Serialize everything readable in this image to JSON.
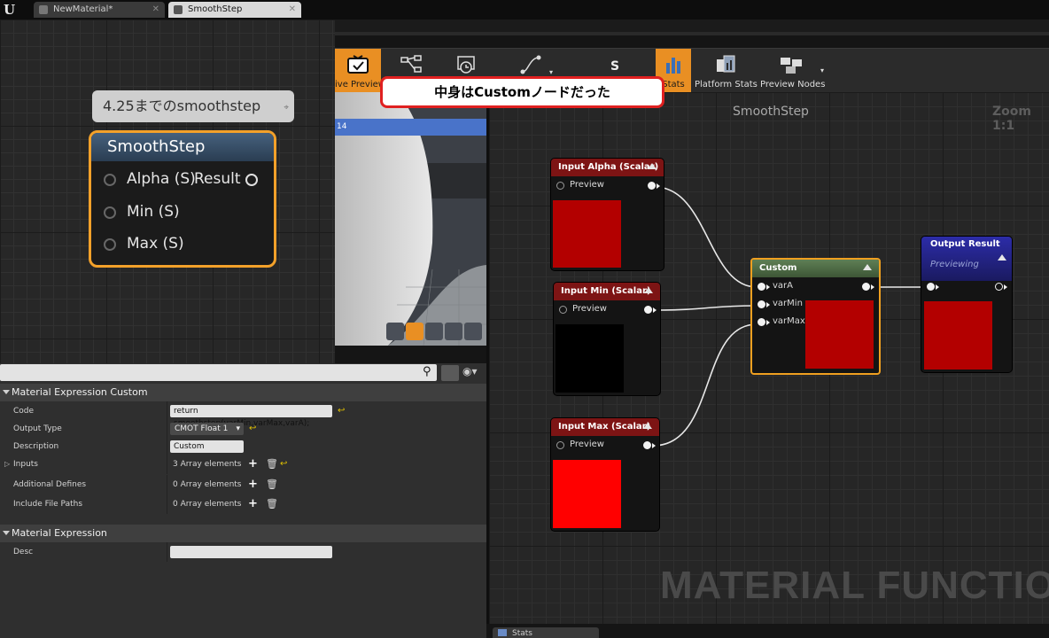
{
  "tabs": [
    {
      "label": "NewMaterial*",
      "active": false
    },
    {
      "label": "SmoothStep",
      "active": true
    }
  ],
  "toolbar": {
    "buttons": [
      {
        "label": "ive Preview",
        "icon": "live-preview-icon",
        "active": true
      },
      {
        "label": "",
        "icon": "hierarchy-icon",
        "active": false
      },
      {
        "label": "",
        "icon": "realtime-icon",
        "active": false
      },
      {
        "label": "",
        "icon": "curve-icon",
        "active": false
      },
      {
        "label": "",
        "icon": "function-icon",
        "active": false
      },
      {
        "label": "Stats",
        "icon": "stats-icon",
        "active": true
      },
      {
        "label": "Platform Stats",
        "icon": "platform-stats-icon",
        "active": false
      },
      {
        "label": "Preview Nodes",
        "icon": "preview-nodes-icon",
        "active": false
      }
    ]
  },
  "callout": "中身はCustomノードだった",
  "viewport": {
    "bar_text": "14"
  },
  "graph": {
    "title": "SmoothStep",
    "zoom": "Zoom 1:1",
    "watermark": "MATERIAL FUNCTION",
    "nodes": {
      "input_alpha": {
        "title": "Input Alpha (Scalar)",
        "pin": "Preview",
        "swatch": "#b30000"
      },
      "input_min": {
        "title": "Input Min (Scalar)",
        "pin": "Preview",
        "swatch": "#000000"
      },
      "input_max": {
        "title": "Input Max (Scalar)",
        "pin": "Preview",
        "swatch": "#ff0000"
      },
      "custom": {
        "title": "Custom",
        "inputs": [
          "varA",
          "varMin",
          "varMax"
        ],
        "swatch": "#b30000"
      },
      "output": {
        "title": "Output Result",
        "subtitle": "Previewing",
        "swatch": "#b30000"
      }
    }
  },
  "comment": "4.25までのsmoothstep",
  "big_node": {
    "title": "SmoothStep",
    "pins": [
      "Alpha (S)",
      "Min (S)",
      "Max (S)"
    ],
    "output": "Result"
  },
  "details": {
    "sections": [
      {
        "title": "Material Expression Custom",
        "props": [
          {
            "name": "Code",
            "value": "return smoothstep(varMin,varMax,varA);"
          },
          {
            "name": "Output Type",
            "value": "CMOT Float 1"
          },
          {
            "name": "Description",
            "value": "Custom"
          },
          {
            "name": "Inputs",
            "value": "3 Array elements"
          },
          {
            "name": "Additional Defines",
            "value": "0 Array elements"
          },
          {
            "name": "Include File Paths",
            "value": "0 Array elements"
          }
        ]
      },
      {
        "title": "Material Expression",
        "props": [
          {
            "name": "Desc",
            "value": ""
          }
        ]
      }
    ]
  },
  "stats_tab": "Stats"
}
